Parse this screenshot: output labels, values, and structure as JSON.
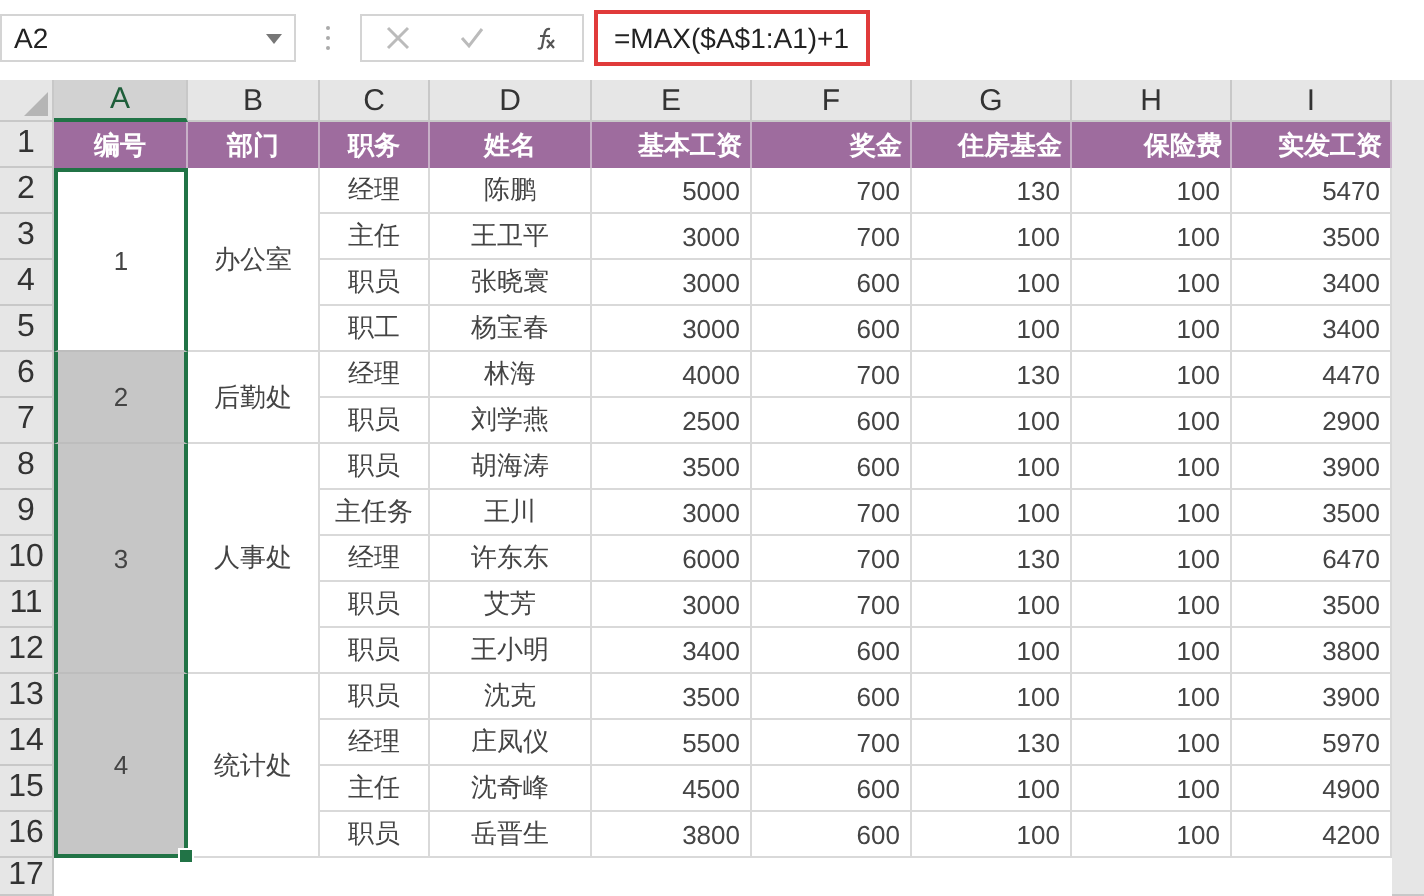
{
  "name_box": {
    "value": "A2"
  },
  "formula_bar": {
    "formula": "=MAX($A$1:A1)+1",
    "highlighted": true
  },
  "columns": [
    {
      "label": "A",
      "selected": true
    },
    {
      "label": "B",
      "selected": false
    },
    {
      "label": "C",
      "selected": false
    },
    {
      "label": "D",
      "selected": false
    },
    {
      "label": "E",
      "selected": false
    },
    {
      "label": "F",
      "selected": false
    },
    {
      "label": "G",
      "selected": false
    },
    {
      "label": "H",
      "selected": false
    },
    {
      "label": "I",
      "selected": false
    }
  ],
  "row_numbers": [
    "1",
    "2",
    "3",
    "4",
    "5",
    "6",
    "7",
    "8",
    "9",
    "10",
    "11",
    "12",
    "13",
    "14",
    "15",
    "16",
    "17"
  ],
  "header": [
    "编号",
    "部门",
    "职务",
    "姓名",
    "基本工资",
    "奖金",
    "住房基金",
    "保险费",
    "实发工资"
  ],
  "groups": [
    {
      "number": "1",
      "department": "办公室",
      "selected": true,
      "active": true,
      "rows": [
        [
          "经理",
          "陈鹏",
          "5000",
          "700",
          "130",
          "100",
          "5470"
        ],
        [
          "主任",
          "王卫平",
          "3000",
          "700",
          "100",
          "100",
          "3500"
        ],
        [
          "职员",
          "张晓寰",
          "3000",
          "600",
          "100",
          "100",
          "3400"
        ],
        [
          "职工",
          "杨宝春",
          "3000",
          "600",
          "100",
          "100",
          "3400"
        ]
      ]
    },
    {
      "number": "2",
      "department": "后勤处",
      "selected": true,
      "active": false,
      "rows": [
        [
          "经理",
          "林海",
          "4000",
          "700",
          "130",
          "100",
          "4470"
        ],
        [
          "职员",
          "刘学燕",
          "2500",
          "600",
          "100",
          "100",
          "2900"
        ]
      ]
    },
    {
      "number": "3",
      "department": "人事处",
      "selected": true,
      "active": false,
      "rows": [
        [
          "职员",
          "胡海涛",
          "3500",
          "600",
          "100",
          "100",
          "3900"
        ],
        [
          "主任务",
          "王川",
          "3000",
          "700",
          "100",
          "100",
          "3500"
        ],
        [
          "经理",
          "许东东",
          "6000",
          "700",
          "130",
          "100",
          "6470"
        ],
        [
          "职员",
          "艾芳",
          "3000",
          "700",
          "100",
          "100",
          "3500"
        ],
        [
          "职员",
          "王小明",
          "3400",
          "600",
          "100",
          "100",
          "3800"
        ]
      ]
    },
    {
      "number": "4",
      "department": "统计处",
      "selected": true,
      "active": false,
      "rows": [
        [
          "职员",
          "沈克",
          "3500",
          "600",
          "100",
          "100",
          "3900"
        ],
        [
          "经理",
          "庄凤仪",
          "5500",
          "700",
          "130",
          "100",
          "5970"
        ],
        [
          "主任",
          "沈奇峰",
          "4500",
          "600",
          "100",
          "100",
          "4900"
        ],
        [
          "职员",
          "岳晋生",
          "3800",
          "600",
          "100",
          "100",
          "4200"
        ]
      ]
    }
  ]
}
